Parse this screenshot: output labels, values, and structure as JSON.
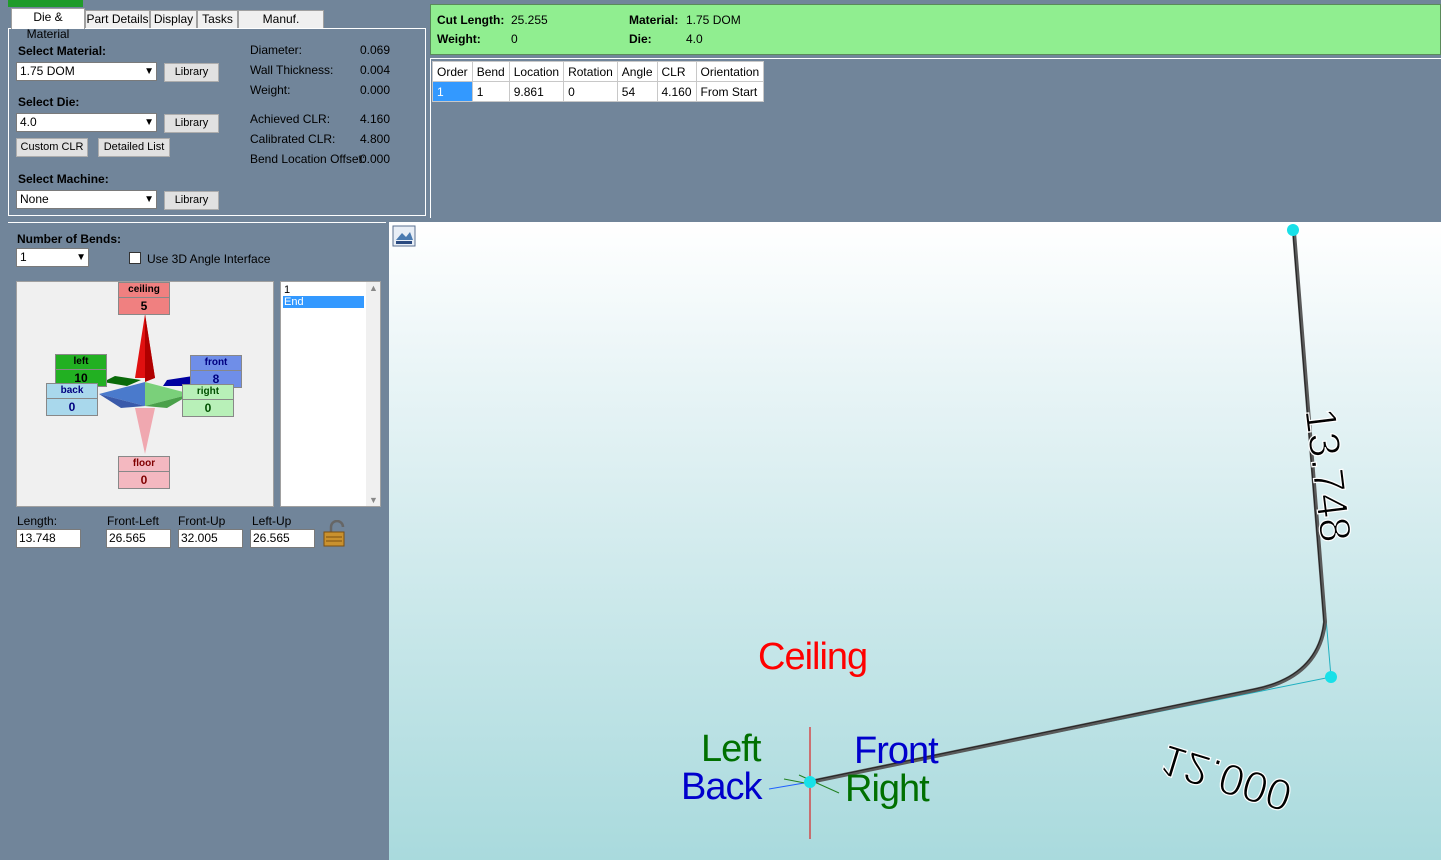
{
  "tabs": [
    "Die & Material",
    "Part Details",
    "Display",
    "Tasks",
    "Manuf. Warning"
  ],
  "die_material": {
    "select_material_label": "Select Material:",
    "material_value": "1.75 DOM",
    "select_die_label": "Select Die:",
    "die_value": "4.0",
    "select_machine_label": "Select Machine:",
    "machine_value": "None",
    "library_label": "Library",
    "custom_clr_label": "Custom CLR",
    "detailed_list_label": "Detailed List",
    "props": [
      {
        "label": "Diameter:",
        "value": "0.069"
      },
      {
        "label": "Wall Thickness:",
        "value": "0.004"
      },
      {
        "label": "Weight:",
        "value": "0.000"
      },
      {
        "label": "Achieved CLR:",
        "value": "4.160"
      },
      {
        "label": "Calibrated CLR:",
        "value": "4.800"
      },
      {
        "label": "Bend Location Offset:",
        "value": "0.000"
      }
    ]
  },
  "summary": {
    "cut_length_label": "Cut Length:",
    "cut_length_value": "25.255",
    "weight_label": "Weight:",
    "weight_value": "0",
    "material_label": "Material:",
    "material_value": "1.75 DOM",
    "die_label": "Die:",
    "die_value": "4.0"
  },
  "bend_table": {
    "headers": [
      "Order",
      "Bend",
      "Location",
      "Rotation",
      "Angle",
      "CLR",
      "Orientation"
    ],
    "rows": [
      [
        "1",
        "1",
        "9.861",
        "0",
        "54",
        "4.160",
        "From Start"
      ]
    ]
  },
  "bends": {
    "number_label": "Number of Bends:",
    "number_value": "1",
    "use_3d_label": "Use 3D Angle Interface",
    "use_3d_checked": false,
    "directions": {
      "ceiling": {
        "label": "ceiling",
        "value": "5"
      },
      "left": {
        "label": "left",
        "value": "10"
      },
      "front": {
        "label": "front",
        "value": "8"
      },
      "back": {
        "label": "back",
        "value": "0"
      },
      "right": {
        "label": "right",
        "value": "0"
      },
      "floor": {
        "label": "floor",
        "value": "0"
      }
    },
    "list_items": [
      "1",
      "End"
    ],
    "selected_item": "End",
    "length_label": "Length:",
    "length_value": "13.748",
    "front_left_label": "Front-Left",
    "front_left_value": "26.565",
    "front_up_label": "Front-Up",
    "front_up_value": "32.005",
    "left_up_label": "Left-Up",
    "left_up_value": "26.565"
  },
  "viewport": {
    "dim_vertical": "13.748",
    "dim_horizontal": "12.000",
    "label_ceiling": "Ceiling",
    "label_left": "Left",
    "label_back": "Back",
    "label_front": "Front",
    "label_right": "Right",
    "colors": {
      "ceiling": "#ff0000",
      "left": "#007000",
      "back": "#0000cc",
      "front": "#0000cc",
      "right": "#007000"
    }
  }
}
